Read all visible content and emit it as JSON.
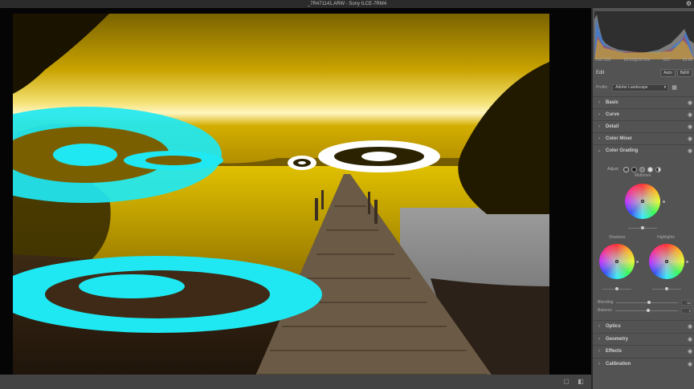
{
  "window": {
    "title": "_7R471141.ARW  -  Sony ILCE-7RM4"
  },
  "camera_info": {
    "iso": "ISO 100",
    "focal": "16-35@30 mm",
    "aperture": "f/22",
    "shutter": "25.8s"
  },
  "edit": {
    "title": "Edit",
    "auto_label": "Auto",
    "bw_label": "B&W",
    "profile_label": "Profile",
    "profile_value": "Adobe Landscape"
  },
  "sections": {
    "basic": "Basic",
    "curve": "Curve",
    "detail": "Detail",
    "color_mixer": "Color Mixer",
    "color_grading": "Color Grading",
    "optics": "Optics",
    "geometry": "Geometry",
    "effects": "Effects",
    "calibration": "Calibration"
  },
  "color_grading": {
    "adjust_label": "Adjust",
    "midtones_label": "Midtones",
    "shadows_label": "Shadows",
    "highlights_label": "Highlights",
    "blending_label": "Blending",
    "blending_value": "50",
    "balance_label": "Balance",
    "balance_value": "0"
  },
  "colors": {
    "overlay_cyan": "#1fe8f2",
    "sky_yellow": "#d6b100",
    "panel_bg": "#535353"
  }
}
